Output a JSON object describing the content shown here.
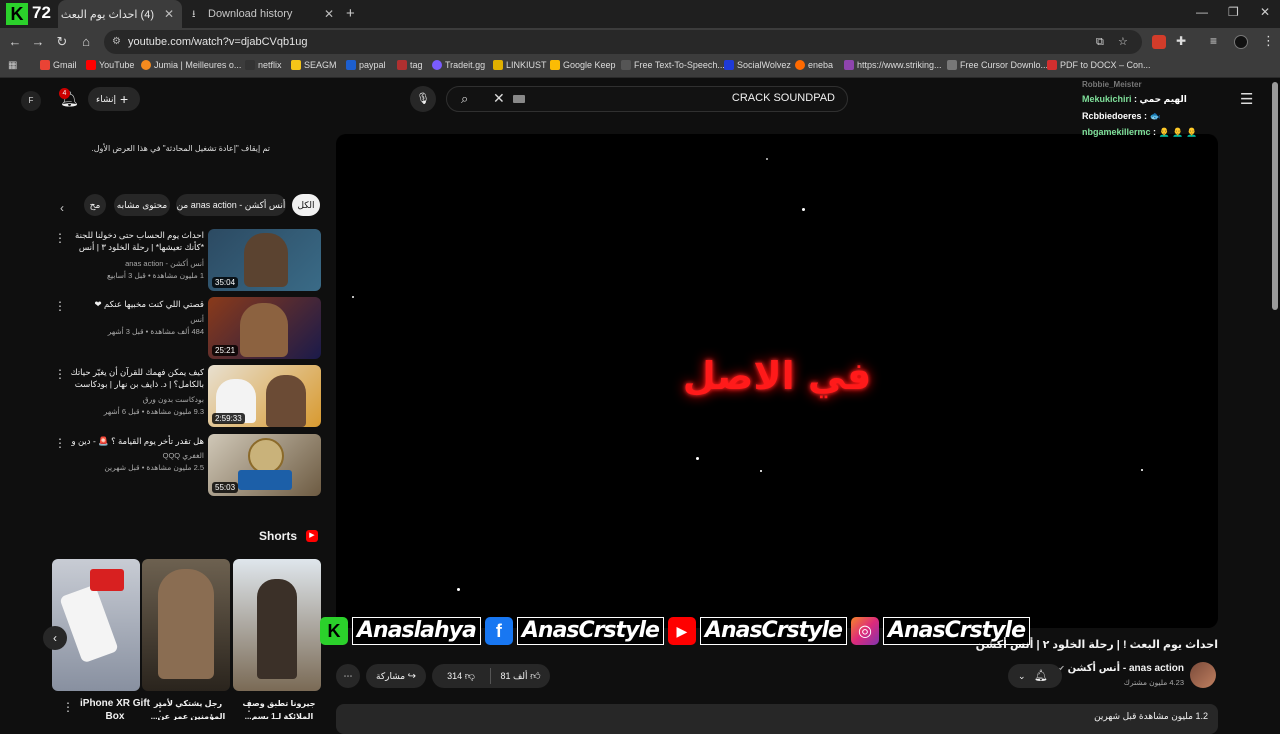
{
  "browser": {
    "tab1": {
      "title": "(4) احداث يوم البعث ! | رحلة"
    },
    "tab2": {
      "title": "Download history"
    },
    "logo_text": "72",
    "url": "youtube.com/watch?v=djabCVqb1ug",
    "bookmarks": [
      "Gmail",
      "YouTube",
      "Jumia | Meilleures o...",
      "netflix",
      "SEAGM",
      "paypal",
      "tag",
      "Tradeit.gg",
      "LINKIUST",
      "Google Keep",
      "Free Text-To-Speech...",
      "SocialWolvez",
      "eneba",
      "https://www.striking...",
      "Free Cursor Downlo...",
      "PDF to DOCX – Con..."
    ]
  },
  "youtube": {
    "avatar_letter": "F",
    "notif_count": "4",
    "create_label": "إنشاء",
    "search_value": "CRACK SOUNDPAD",
    "chat_notice": "تم إيقاف \"إعادة تشغيل المحادثة\" في هذا العرض الأول.",
    "chips": [
      "الكل",
      "من anas action - أنس أكشن",
      "محتوى مشابه",
      "مح"
    ],
    "recommendations": [
      {
        "title": "احداث يوم الحساب حتى دخولنا للجنة *كأنك تعيشها* | رحلة الخلود ٣ | أنس أكشن",
        "channel": "أنس أكشن - anas action",
        "meta": "1 مليون مشاهدة • قبل 3 أسابيع",
        "duration": "35:04"
      },
      {
        "title": "قصتي اللي كنت مخبيها عنكم ❤",
        "channel": "أنس",
        "meta": "484 ألف مشاهدة • قبل 3 أشهر",
        "duration": "25:21"
      },
      {
        "title": "كيف يمكن فهمك للقرآن أن يغيّر حياتك بالكامل؟ | د. ذايف بن نهار | بودكاست بدون...",
        "channel": "بودكاست بدون ورق",
        "meta": "9.3 مليون مشاهدة • قبل 6 أشهر",
        "duration": "2:59:33"
      },
      {
        "title": "هل تقدر تأخر يوم القيامة ؟ 🚨 - دين و طين",
        "channel": "الغفري QQQ",
        "meta": "2.5 مليون مشاهدة • قبل شهرين",
        "duration": "55:03"
      }
    ],
    "shorts_label": "Shorts",
    "shorts": [
      {
        "title": "جيرونا تطبق وصف الملائكة لـ1 بسم..."
      },
      {
        "title": "رجل يشتكي لأمير المؤمنين عمر عن..."
      },
      {
        "title": "iPhone XR Gift Box"
      }
    ],
    "video_overlay_text": "في الاصل",
    "social_handles": [
      {
        "icon": "K",
        "handle": "Anaslahya"
      },
      {
        "icon": "f",
        "handle": "AnasCrstyle"
      },
      {
        "icon": "▶",
        "handle": "AnasCrstyle"
      },
      {
        "icon": "◎",
        "handle": "AnasCrstyle"
      }
    ],
    "video_title": "احداث يوم البعث ! | رحلة الخلود ٢ | أنس أكشن",
    "channel_name": "anas action - أنس أكشن",
    "subscribers": "4.23 مليون مشترك",
    "likes": "81 ألف",
    "dislikes": "314",
    "share_label": "مشاركة",
    "views_partial": "1.2 مليون مشاهدة قبل شهرين",
    "chat_messages": [
      {
        "user": "Mekukichiri",
        "text": ": الهيم حمي"
      },
      {
        "user": "Rcbbiedoeres",
        "text": ": 🐟"
      },
      {
        "user": "nbgamekillermc",
        "text": ": 👨‍🦲 👨‍🦲 👨‍🦲"
      }
    ],
    "chat_user_above": "Robbie_Meister",
    "colors": {
      "accent": "#ff0000",
      "chat_green": "#7fe09a"
    }
  }
}
